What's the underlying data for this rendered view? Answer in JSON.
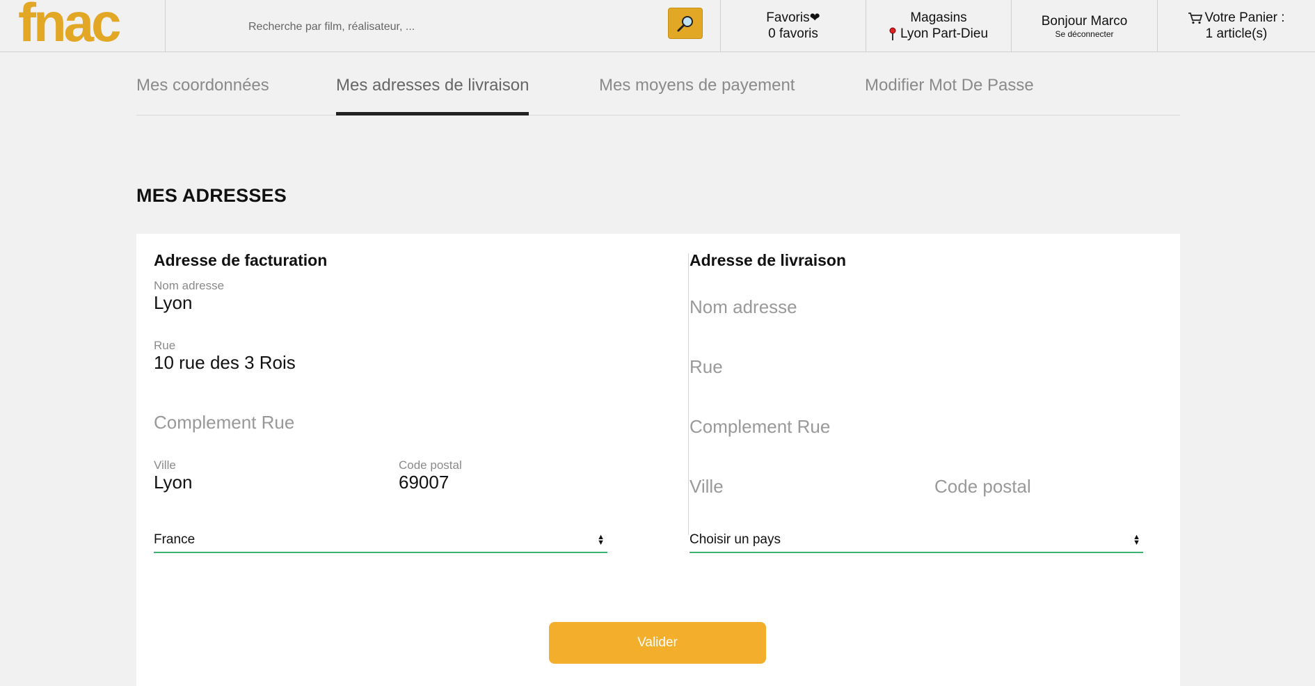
{
  "header": {
    "logo": "fnac",
    "search": {
      "placeholder": "Recherche par film, réalisateur, ..."
    },
    "favoris": {
      "title": "Favoris",
      "count": "0 favoris"
    },
    "magasins": {
      "title": "Magasins",
      "store": "Lyon Part-Dieu"
    },
    "user": {
      "greeting": "Bonjour Marco",
      "logout": "Se déconnecter"
    },
    "cart": {
      "title": "Votre Panier :",
      "count": "1 article(s)"
    }
  },
  "tabs": [
    {
      "label": "Mes coordonnées"
    },
    {
      "label": "Mes adresses de livraison"
    },
    {
      "label": "Mes moyens de payement"
    },
    {
      "label": "Modifier Mot De Passe"
    }
  ],
  "section_title": "MES ADRESSES",
  "billing": {
    "title": "Adresse de facturation",
    "name_label": "Nom adresse",
    "name_value": "Lyon",
    "street_label": "Rue",
    "street_value": "10 rue des 3 Rois",
    "complement_placeholder": "Complement Rue",
    "city_label": "Ville",
    "city_value": "Lyon",
    "zip_label": "Code postal",
    "zip_value": "69007",
    "country": "France"
  },
  "shipping": {
    "title": "Adresse de livraison",
    "name_placeholder": "Nom adresse",
    "street_placeholder": "Rue",
    "complement_placeholder": "Complement Rue",
    "city_placeholder": "Ville",
    "zip_placeholder": "Code postal",
    "country": "Choisir un pays"
  },
  "submit_label": "Valider",
  "colors": {
    "brand": "#e1a725",
    "button": "#f3ae2b",
    "select_underline": "#3cb371"
  }
}
